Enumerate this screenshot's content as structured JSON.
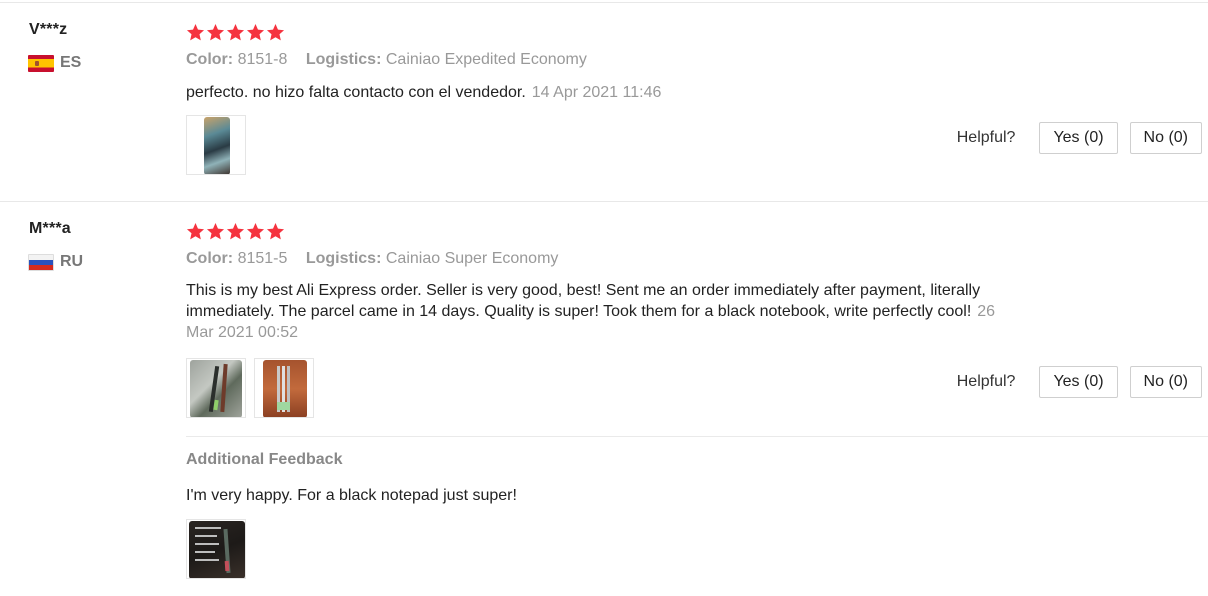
{
  "reviews": [
    {
      "user": "V***z",
      "country": "ES",
      "rating": 5,
      "color_label": "Color:",
      "color_value": "8151-8",
      "logistics_label": "Logistics:",
      "logistics_value": "Cainiao Expedited Economy",
      "text": "perfecto. no hizo falta contacto con el vendedor.",
      "date": "14 Apr 2021 11:46",
      "helpful_label": "Helpful?",
      "yes_label": "Yes (0)",
      "no_label": "No (0)"
    },
    {
      "user": "M***a",
      "country": "RU",
      "rating": 5,
      "color_label": "Color:",
      "color_value": "8151-5",
      "logistics_label": "Logistics:",
      "logistics_value": "Cainiao Super Economy",
      "text_line1": "This is my best Ali Express order. Seller is very good, best! Sent me an order immediately after payment, literally",
      "text_line2": "immediately. The parcel came in 14 days. Quality is super! Took them for a black notebook, write perfectly cool!",
      "date_part1": "26",
      "date_part2": "Mar 2021 00:52",
      "helpful_label": "Helpful?",
      "yes_label": "Yes (0)",
      "no_label": "No (0)",
      "additional_title": "Additional Feedback",
      "additional_text": "I'm very happy. For a black notepad just super!"
    }
  ],
  "colors": {
    "star": "#f5333f",
    "muted": "#999999",
    "border": "#e8e8e8"
  }
}
